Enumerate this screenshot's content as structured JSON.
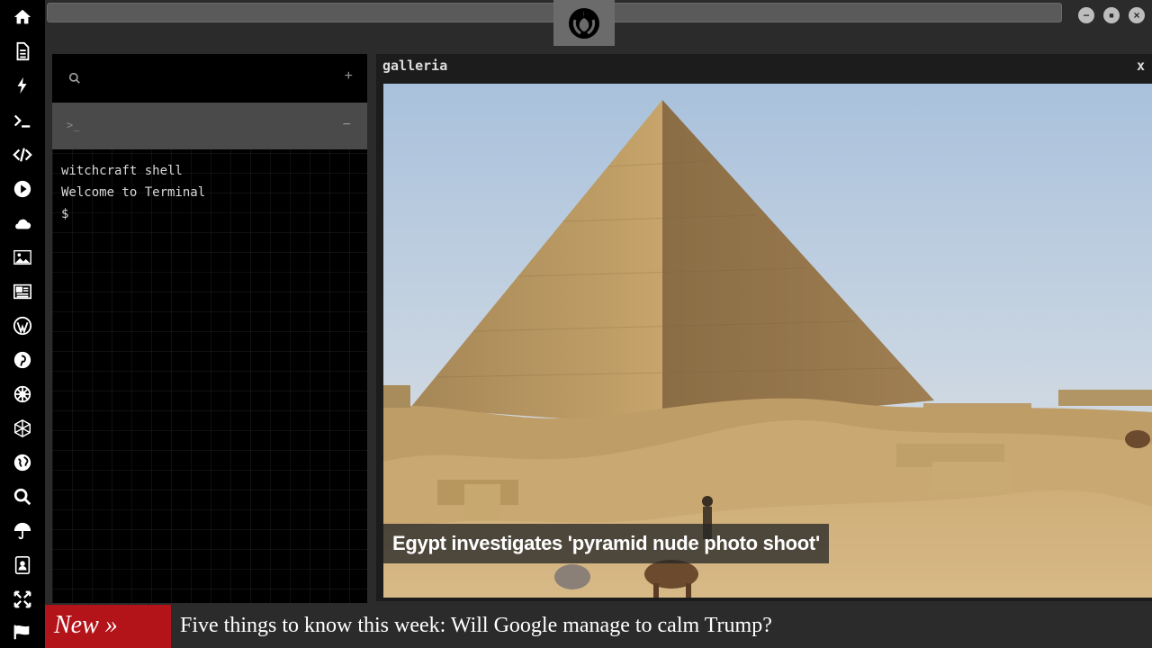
{
  "sidebar": {
    "icons": [
      "home-icon",
      "document-icon",
      "lightning-icon",
      "terminal-icon",
      "code-icon",
      "play-icon",
      "cloud-icon",
      "image-icon",
      "newspaper-icon",
      "wordpress-icon",
      "pinterest-icon",
      "rebel-wheel-icon",
      "atom-icon",
      "globe-icon",
      "search-icon",
      "umbrella-icon",
      "contacts-icon",
      "expand-icon",
      "flag-icon"
    ]
  },
  "topbar": {
    "logo_icon": "rebel-alliance-icon",
    "window_buttons": [
      "minimize",
      "maximize",
      "close"
    ]
  },
  "terminal": {
    "search_icon": "search-icon",
    "add_label": "+",
    "tab_prompt": ">_",
    "tab_minus": "−",
    "lines": [
      "witchcraft shell",
      "Welcome to Terminal",
      "$"
    ]
  },
  "galleria": {
    "title": "galleria",
    "close": "x",
    "caption": "Egypt investigates 'pyramid nude photo shoot'"
  },
  "ticker": {
    "label": "New »",
    "headline": "Five things to know this week: Will Google manage to calm Trump?"
  },
  "colors": {
    "ticker_label_bg": "#b3141a",
    "panel_bg": "#000000",
    "chrome_bg": "#2b2b2b"
  }
}
